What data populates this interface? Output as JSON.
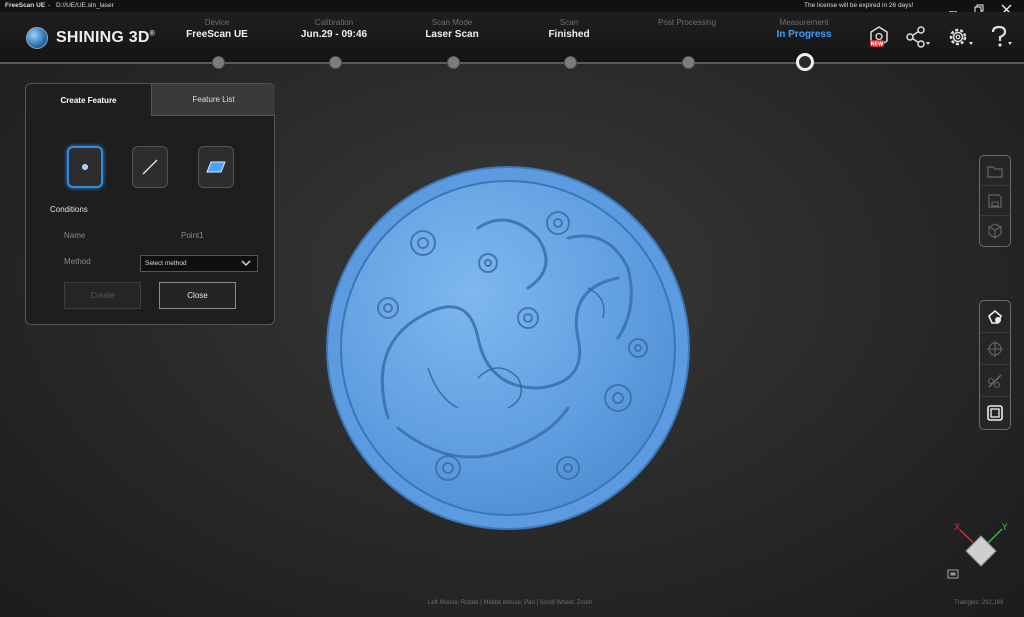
{
  "titlebar": {
    "app": "FreeScan UE",
    "separator": "-",
    "path": "D://UE/UE.sln_laser",
    "license": "The license will be expired in 26 days!"
  },
  "header": {
    "logo_text": "SHINING 3D",
    "logo_reg": "®",
    "steps": [
      {
        "label": "Device",
        "value": "FreeScan UE"
      },
      {
        "label": "Calibration",
        "value": "Jun.29 - 09:46"
      },
      {
        "label": "Scan Mode",
        "value": "Laser Scan"
      },
      {
        "label": "Scan",
        "value": "Finished"
      },
      {
        "label": "Post Processing",
        "value": ""
      },
      {
        "label": "Measurement",
        "value": "In Progress"
      }
    ],
    "icons": [
      "new-feature-icon",
      "share-icon",
      "settings-icon",
      "help-icon"
    ],
    "new_badge": "NEW"
  },
  "panel": {
    "tabs": [
      "Create Feature",
      "Feature List"
    ],
    "feature_types": [
      "point-feature-icon",
      "line-feature-icon",
      "plane-feature-icon"
    ],
    "conditions_label": "Conditions",
    "name_label": "Name",
    "name_value": "Point1",
    "method_label": "Method",
    "method_value": "Select method",
    "create_label": "Create",
    "close_label": "Close"
  },
  "footer": {
    "hint": "Left Mouse: Rotate | Middle Mouse: Pan | Scroll Wheel: Zoom",
    "triangles": "Triangles: 292,168"
  },
  "axis": {
    "x": "X",
    "y": "Y"
  },
  "colors": {
    "accent": "#3aa2ff",
    "model": "#6aa8e8"
  }
}
